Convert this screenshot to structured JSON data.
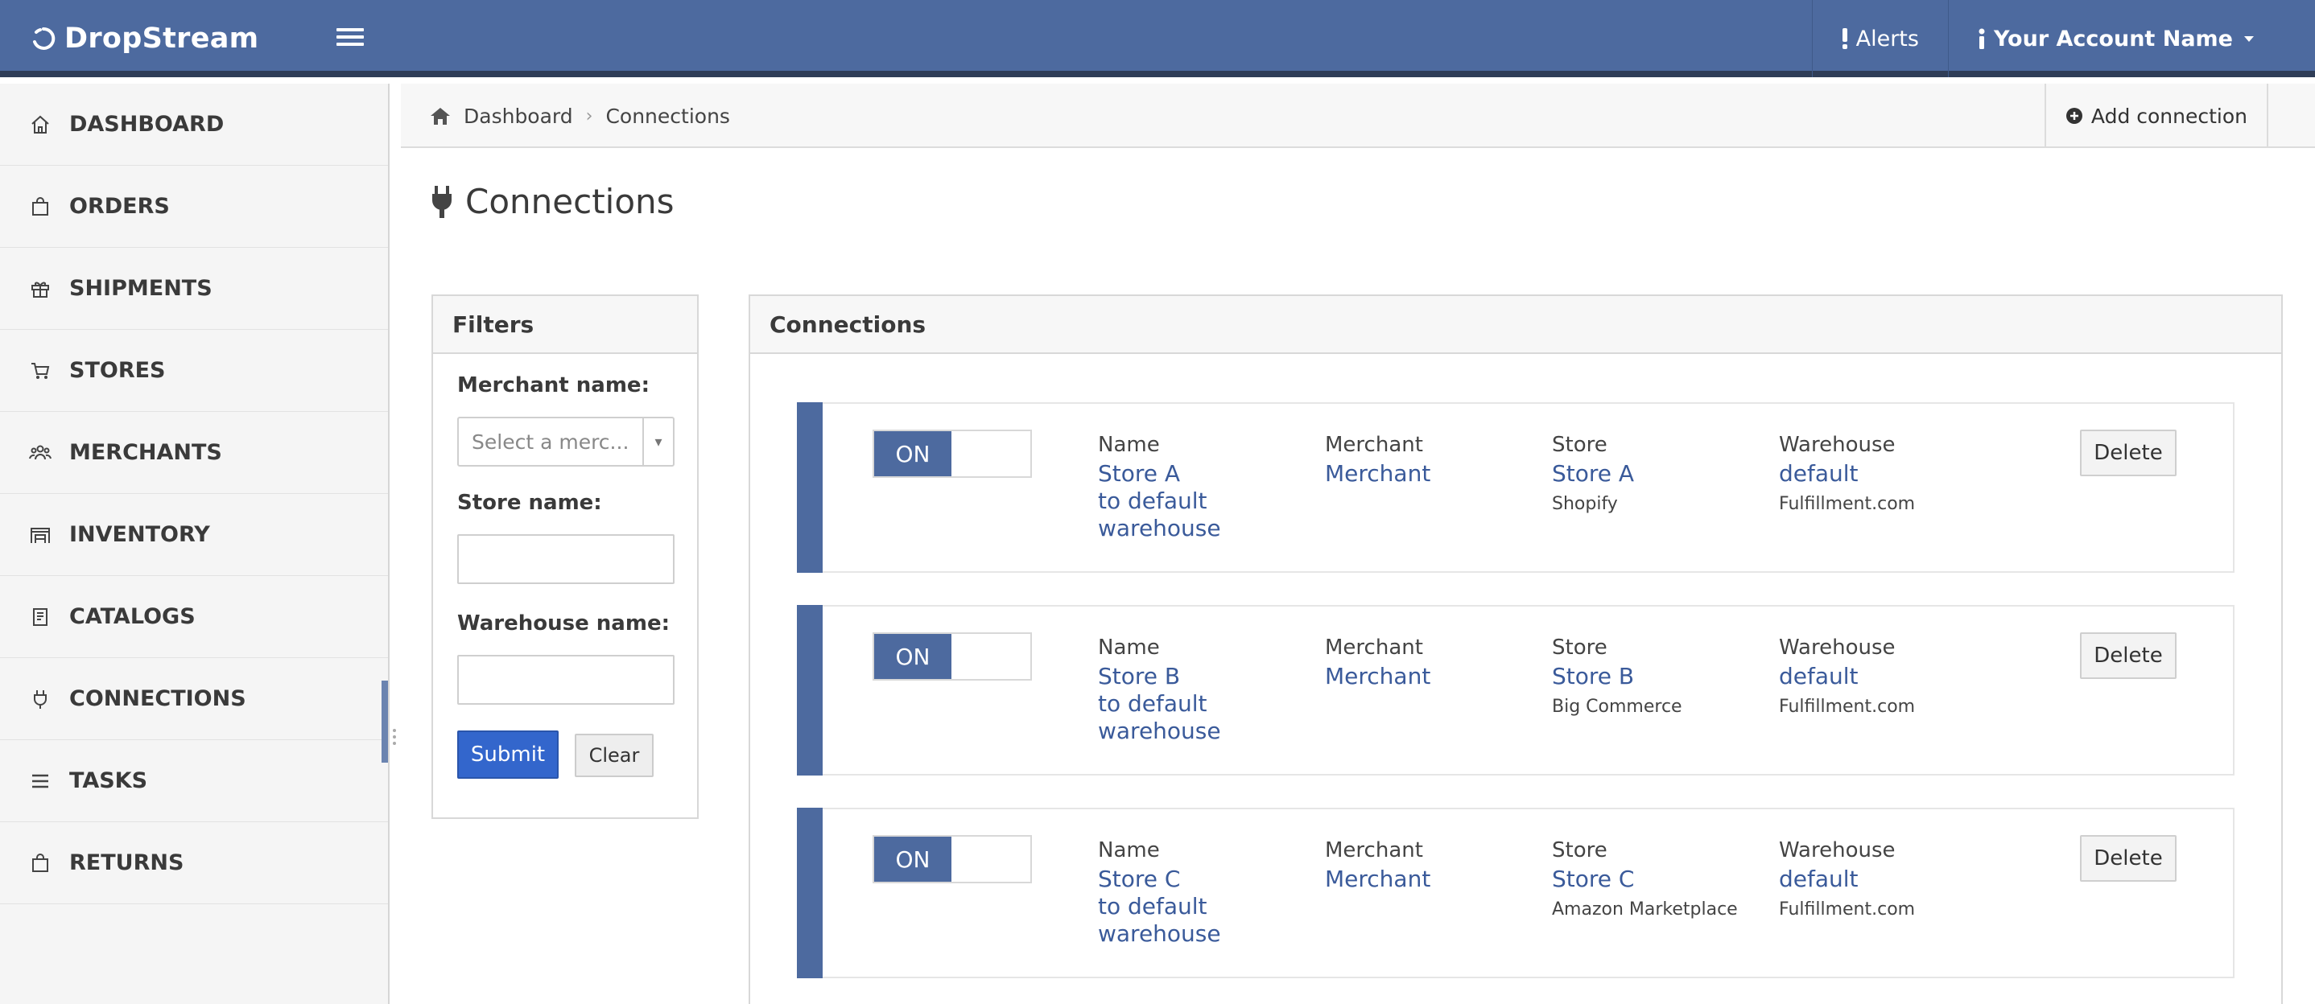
{
  "app": {
    "brand": "DropStream",
    "alerts_label": "Alerts",
    "account_label": "Your Account Name"
  },
  "sidebar": {
    "items": [
      {
        "label": "DASHBOARD",
        "icon": "home-icon"
      },
      {
        "label": "ORDERS",
        "icon": "bag-icon"
      },
      {
        "label": "SHIPMENTS",
        "icon": "gift-icon"
      },
      {
        "label": "STORES",
        "icon": "cart-icon"
      },
      {
        "label": "MERCHANTS",
        "icon": "users-icon"
      },
      {
        "label": "INVENTORY",
        "icon": "warehouse-icon"
      },
      {
        "label": "CATALOGS",
        "icon": "book-icon"
      },
      {
        "label": "CONNECTIONS",
        "icon": "plug-icon"
      },
      {
        "label": "TASKS",
        "icon": "list-icon"
      },
      {
        "label": "RETURNS",
        "icon": "bag-icon"
      }
    ],
    "active": "CONNECTIONS"
  },
  "breadcrumb": {
    "home": "Dashboard",
    "current": "Connections"
  },
  "header": {
    "add_connection": "Add connection",
    "page_title": "Connections"
  },
  "filters": {
    "title": "Filters",
    "merchant_label": "Merchant name:",
    "merchant_placeholder": "Select a merc...",
    "store_label": "Store name:",
    "store_value": "",
    "warehouse_label": "Warehouse name:",
    "warehouse_value": "",
    "submit": "Submit",
    "clear": "Clear"
  },
  "connections": {
    "title": "Connections",
    "col_name": "Name",
    "col_merchant": "Merchant",
    "col_store": "Store",
    "col_warehouse": "Warehouse",
    "delete_label": "Delete",
    "items": [
      {
        "toggle": "ON",
        "name": [
          "Store A",
          "to default",
          "warehouse"
        ],
        "merchant": "Merchant",
        "store": "Store A",
        "store_platform": "Shopify",
        "warehouse": "default",
        "warehouse_provider": "Fulfillment.com"
      },
      {
        "toggle": "ON",
        "name": [
          "Store B",
          "to default",
          "warehouse"
        ],
        "merchant": "Merchant",
        "store": "Store B",
        "store_platform": "Big Commerce",
        "warehouse": "default",
        "warehouse_provider": "Fulfillment.com"
      },
      {
        "toggle": "ON",
        "name": [
          "Store C",
          "to default",
          "warehouse"
        ],
        "merchant": "Merchant",
        "store": "Store C",
        "store_platform": "Amazon Marketplace",
        "warehouse": "default",
        "warehouse_provider": "Fulfillment.com"
      }
    ]
  },
  "colors": {
    "nav": "#4d6a9f",
    "link": "#3a5a9a",
    "submit": "#3366cc"
  }
}
